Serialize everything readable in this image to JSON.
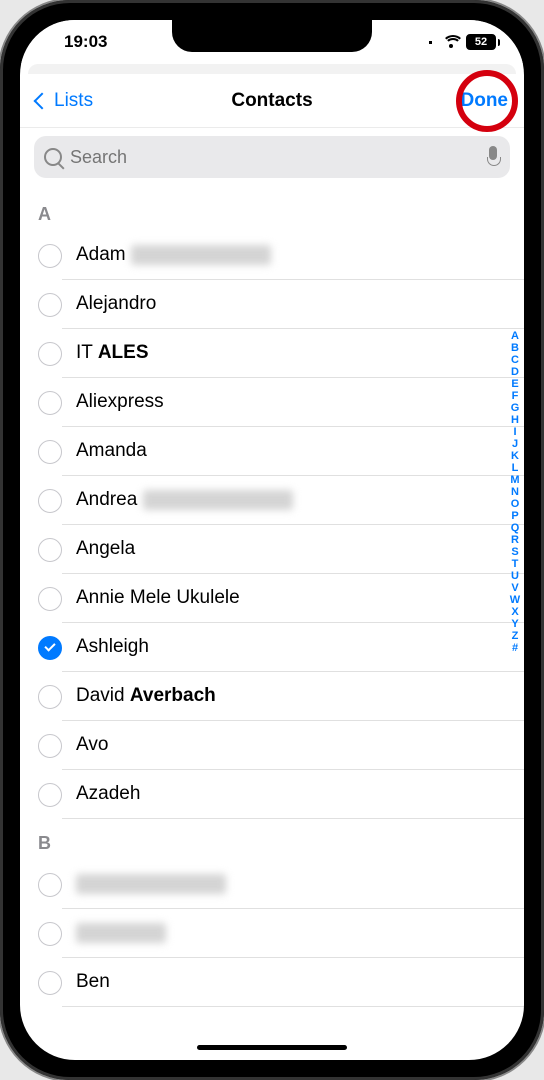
{
  "status": {
    "time": "19:03",
    "battery_level": "52"
  },
  "nav": {
    "back_label": "Lists",
    "title": "Contacts",
    "done_label": "Done"
  },
  "search": {
    "placeholder": "Search"
  },
  "sections": [
    {
      "letter": "A"
    },
    {
      "letter": "B"
    }
  ],
  "contacts_a": [
    {
      "first": "Adam",
      "last_hidden": true,
      "selected": false,
      "blur_w": 140
    },
    {
      "first": "Alejandro",
      "last": "",
      "selected": false
    },
    {
      "first": "IT",
      "last": "ALES",
      "selected": false
    },
    {
      "first": "Aliexpress",
      "last": "",
      "selected": false
    },
    {
      "first": "Amanda",
      "last": "",
      "selected": false
    },
    {
      "first": "Andrea",
      "last_hidden": true,
      "selected": false,
      "blur_w": 150
    },
    {
      "first": "Angela",
      "last": "",
      "selected": false
    },
    {
      "first": "Annie Mele Ukulele",
      "last": "",
      "selected": false
    },
    {
      "first": "Ashleigh",
      "last": "",
      "selected": true
    },
    {
      "first": "David",
      "last": "Averbach",
      "selected": false
    },
    {
      "first": "Avo",
      "last": "",
      "selected": false
    },
    {
      "first": "Azadeh",
      "last": "",
      "selected": false
    }
  ],
  "contacts_b": [
    {
      "first_hidden": true,
      "blur_w": 150,
      "selected": false
    },
    {
      "first_hidden": true,
      "blur_w": 90,
      "selected": false
    },
    {
      "first": "Ben",
      "last": "",
      "selected": false
    }
  ],
  "index": [
    "A",
    "B",
    "C",
    "D",
    "E",
    "F",
    "G",
    "H",
    "I",
    "J",
    "K",
    "L",
    "M",
    "N",
    "O",
    "P",
    "Q",
    "R",
    "S",
    "T",
    "U",
    "V",
    "W",
    "X",
    "Y",
    "Z",
    "#"
  ]
}
